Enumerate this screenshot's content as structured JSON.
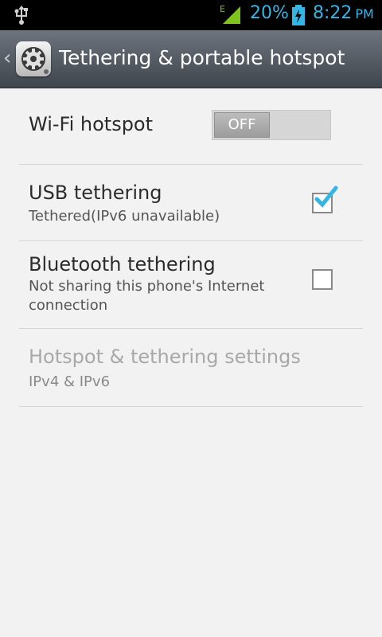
{
  "status_bar": {
    "battery_percent": "20%",
    "time": "8:22",
    "ampm": "PM",
    "network_type": "E",
    "accent_color": "#34b5e5"
  },
  "action_bar": {
    "title": "Tethering & portable hotspot",
    "icon": "settings-gear-icon"
  },
  "list": {
    "wifi_hotspot": {
      "title": "Wi-Fi hotspot",
      "toggle_label": "OFF",
      "enabled": false
    },
    "usb_tethering": {
      "title": "USB tethering",
      "subtitle": "Tethered(IPv6 unavailable)",
      "checked": true
    },
    "bluetooth_tethering": {
      "title": "Bluetooth tethering",
      "subtitle": "Not sharing this phone's Internet connection",
      "checked": false
    },
    "hotspot_settings": {
      "title": "Hotspot & tethering settings",
      "subtitle": "IPv4 & IPv6",
      "disabled": true
    }
  }
}
